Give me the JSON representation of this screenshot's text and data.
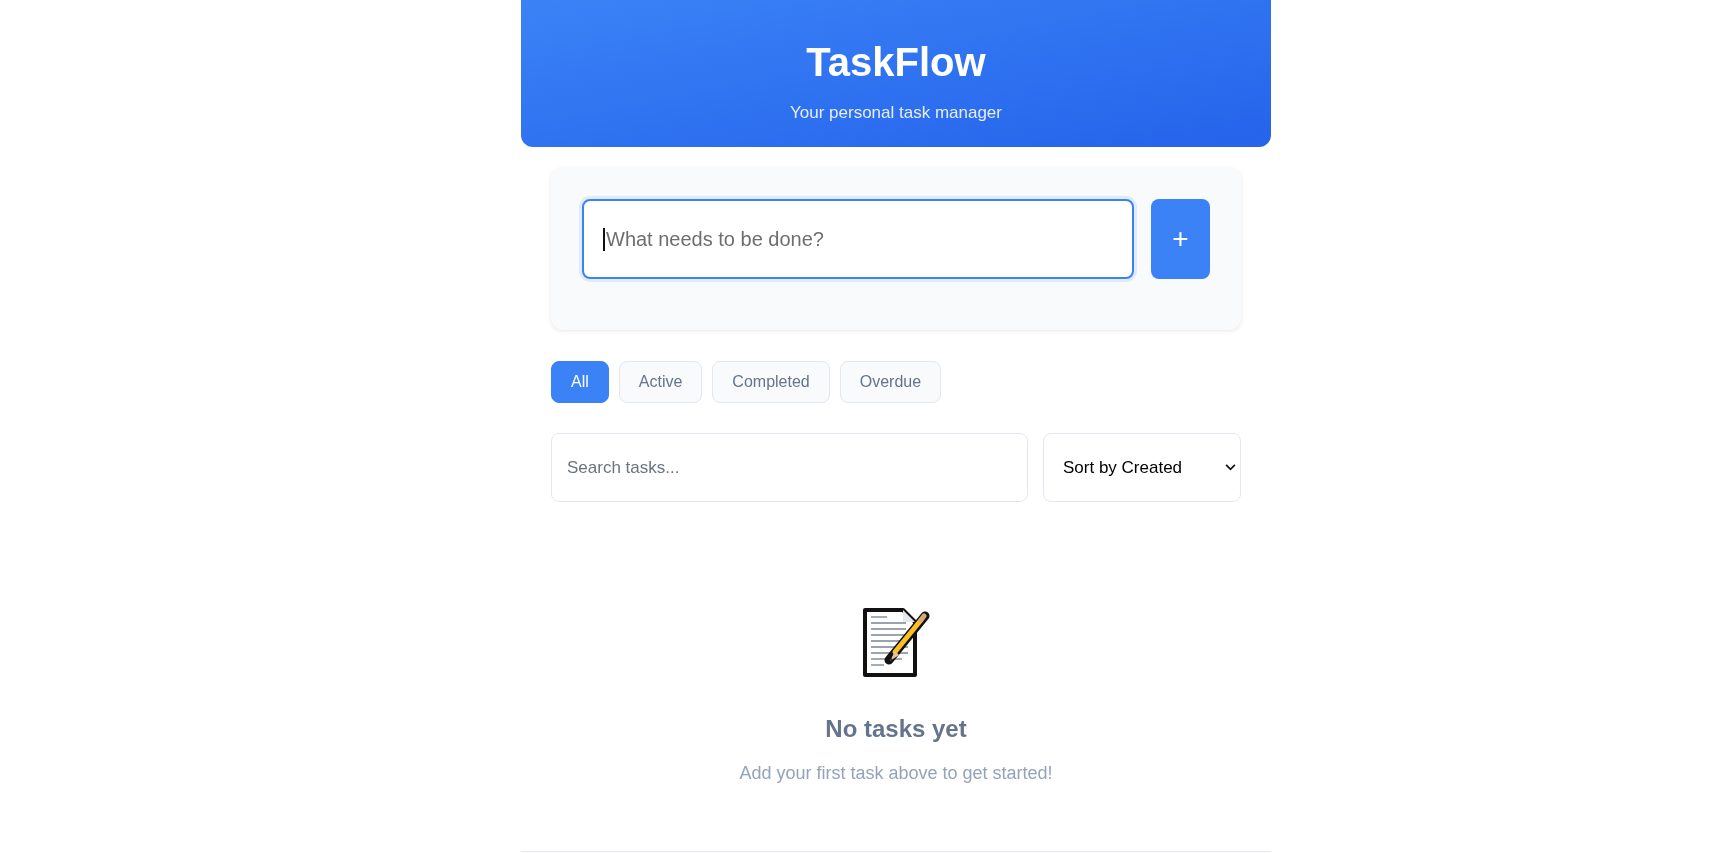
{
  "header": {
    "title": "TaskFlow",
    "subtitle": "Your personal task manager"
  },
  "new_task": {
    "input": {
      "placeholder": "What needs to be done?",
      "focused": true
    },
    "add_button": {
      "label": "+"
    }
  },
  "filters": [
    {
      "label": "All",
      "selected": true
    },
    {
      "label": "Active",
      "selected": false
    },
    {
      "label": "Completed",
      "selected": false
    },
    {
      "label": "Overdue",
      "selected": false
    }
  ],
  "search": {
    "placeholder": "Search tasks..."
  },
  "sort": {
    "value": "Sort by Created"
  },
  "empty_state": {
    "title": "No tasks yet",
    "message": "Add your first task above to get started!"
  }
}
